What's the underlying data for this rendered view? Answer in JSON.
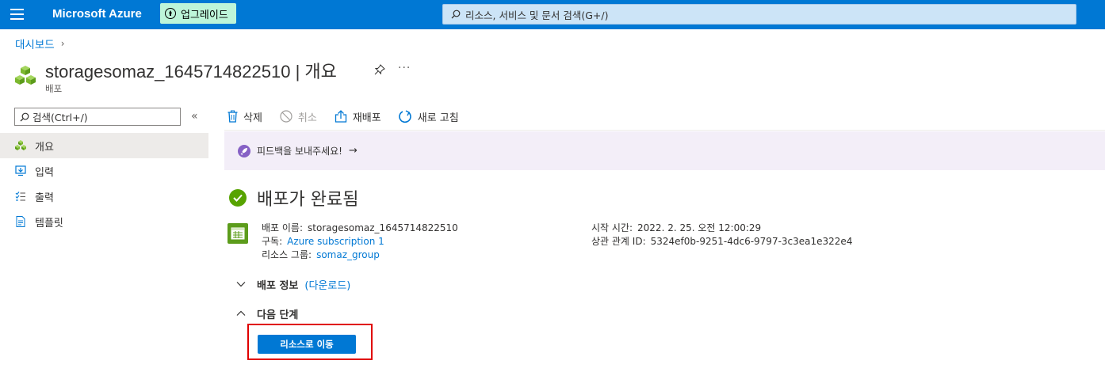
{
  "topbar": {
    "brand": "Microsoft Azure",
    "upgrade_label": "업그레이드",
    "search_placeholder": "리소스, 서비스 및 문서 검색(G+/)"
  },
  "breadcrumb": {
    "home": "대시보드"
  },
  "header": {
    "title": "storagesomaz_1645714822510 | 개요",
    "subtitle": "배포"
  },
  "sidebar": {
    "search_placeholder": "검색(Ctrl+/)",
    "collapse_glyph": "«",
    "items": [
      {
        "label": "개요",
        "icon": "overview-cubes-icon",
        "active": true
      },
      {
        "label": "입력",
        "icon": "input-icon",
        "active": false
      },
      {
        "label": "출력",
        "icon": "output-list-icon",
        "active": false
      },
      {
        "label": "템플릿",
        "icon": "template-icon",
        "active": false
      }
    ]
  },
  "toolbar": {
    "delete": "삭제",
    "cancel": "취소",
    "redeploy": "재배포",
    "refresh": "새로 고침"
  },
  "feedback": {
    "text": "피드백을 보내주세요!",
    "arrow": "→"
  },
  "deployment": {
    "status_title": "배포가 완료됨",
    "name_label": "배포 이름:",
    "name_value": "storagesomaz_1645714822510",
    "subscription_label": "구독:",
    "subscription_value": "Azure subscription 1",
    "resource_group_label": "리소스 그룹:",
    "resource_group_value": "somaz_group",
    "start_time_label": "시작 시간:",
    "start_time_value": "2022. 2. 25. 오전 12:00:29",
    "correlation_label": "상관 관계 ID:",
    "correlation_value": "5324ef0b-9251-4dc6-9797-3c3ea1e322e4"
  },
  "sections": {
    "details_title": "배포 정보",
    "details_link": "(다운로드)",
    "next_steps_title": "다음 단계",
    "go_to_resource": "리소스로 이동"
  },
  "colors": {
    "topbar": "#0078d4",
    "accent": "#0078d4",
    "success": "#57a300",
    "highlight_box": "#e00000"
  }
}
